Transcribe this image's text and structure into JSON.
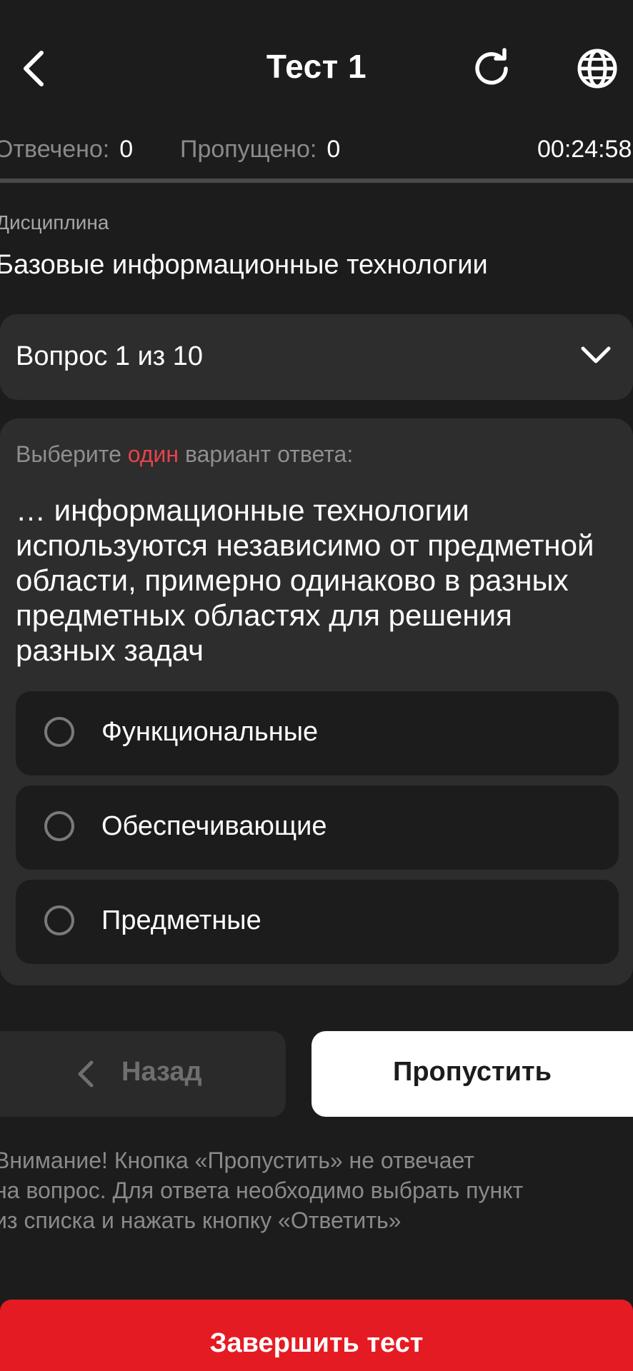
{
  "header": {
    "title": "Тест 1",
    "back_icon": "chevron-left-icon",
    "refresh_icon": "refresh-icon",
    "language_icon": "globe-icon"
  },
  "stats": {
    "answered_label": "Отвечено:",
    "answered_value": "0",
    "skipped_label": "Пропущено:",
    "skipped_value": "0",
    "timer": "00:24:58"
  },
  "discipline": {
    "label": "Дисциплина",
    "name": "Базовые информационные технологии"
  },
  "question_selector": {
    "label": "Вопрос 1 из 10"
  },
  "question": {
    "instruction_prefix": "Выберите",
    "instruction_accent": "один",
    "instruction_suffix": "вариант ответа:",
    "text": "… информационные технологии используются независимо от предметной области, примерно одинаково в разных предметных областях для решения разных задач",
    "options": [
      {
        "label": "Функциональные"
      },
      {
        "label": "Обеспечивающие"
      },
      {
        "label": "Предметные"
      }
    ]
  },
  "actions": {
    "back_label": "Назад",
    "skip_label": "Пропустить",
    "finish_label": "Завершить тест"
  },
  "warning": {
    "line1": "Внимание! Кнопка «Пропустить» не отвечает",
    "line2": "на вопрос. Для ответа необходимо выбрать пункт",
    "line3": "из списка и нажать кнопку «Ответить»"
  },
  "colors": {
    "background": "#1c1c1c",
    "card": "#2d2d2d",
    "accent_red": "#e51b23",
    "accent_text_red": "#e8424a"
  }
}
